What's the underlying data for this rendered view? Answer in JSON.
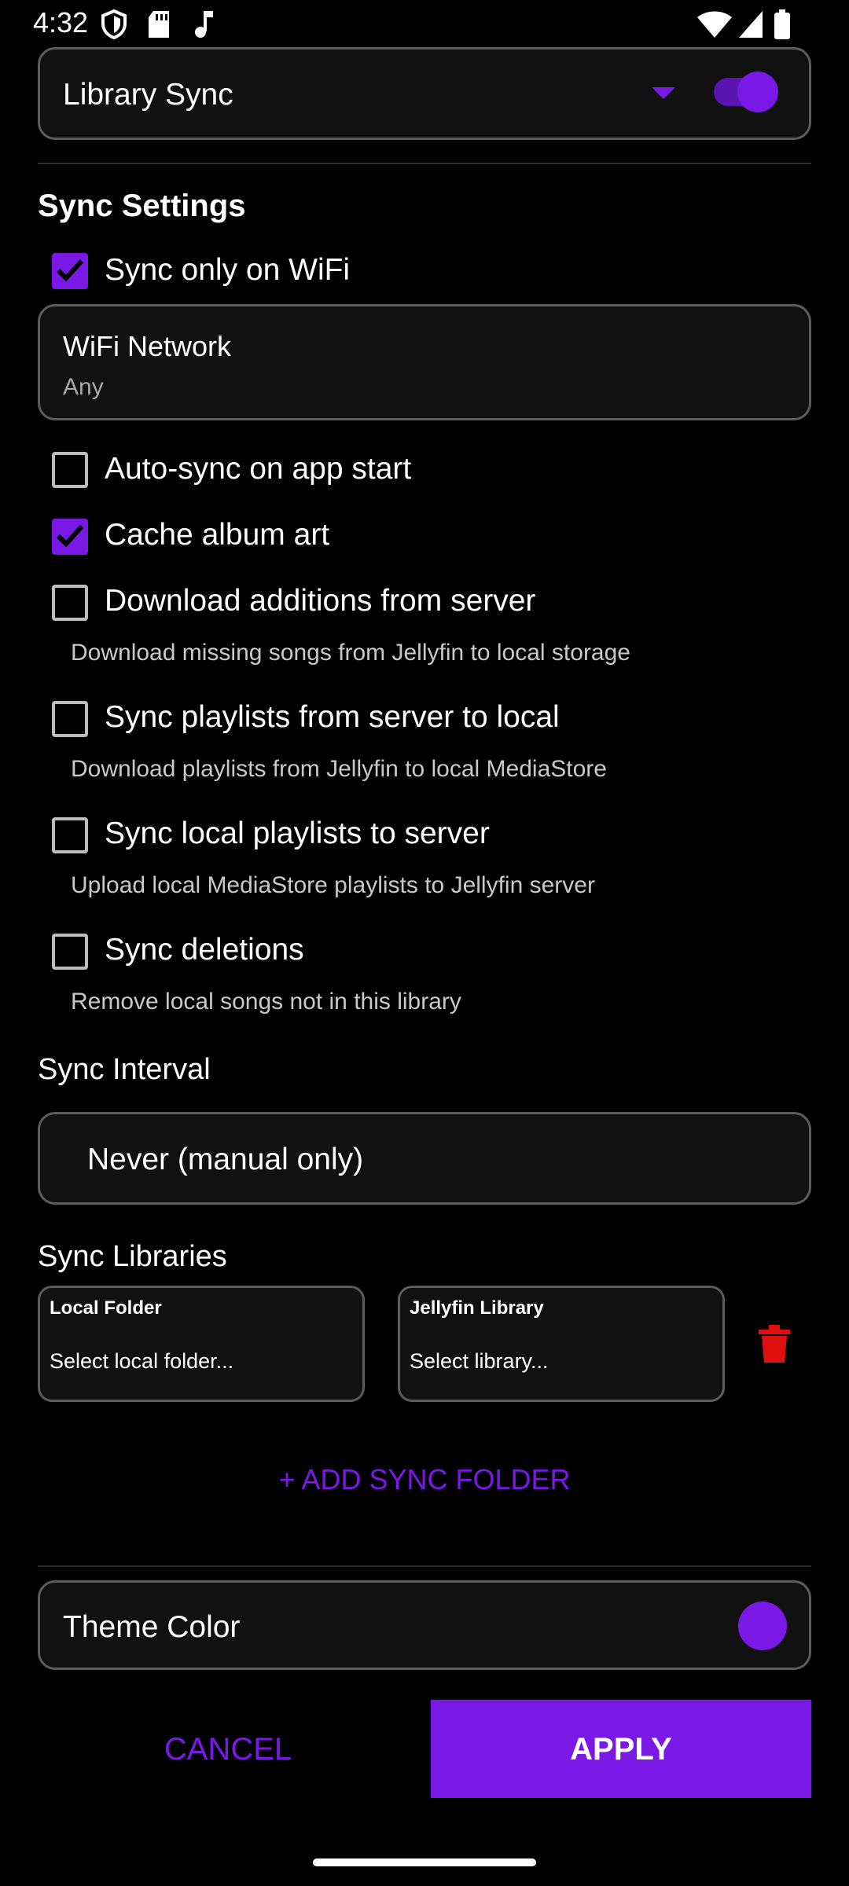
{
  "status_bar": {
    "time": "4:32",
    "icons": [
      "shield-icon",
      "sd-card-icon",
      "music-note-icon",
      "wifi-icon",
      "signal-icon",
      "battery-icon"
    ]
  },
  "library_card": {
    "title": "Library Sync",
    "dropdown_icon": "chevron-down-icon",
    "toggle_on": true
  },
  "sync_settings": {
    "title": "Sync Settings",
    "wifi_only": {
      "label": "Sync only on WiFi",
      "checked": true
    },
    "wifi_network": {
      "label": "WiFi Network",
      "value": "Any"
    },
    "options": [
      {
        "label": "Auto-sync on app start",
        "checked": false,
        "description": ""
      },
      {
        "label": "Cache album art",
        "checked": true,
        "description": ""
      },
      {
        "label": "Download additions from server",
        "checked": false,
        "description": "Download missing songs from Jellyfin to local storage"
      },
      {
        "label": "Sync playlists from server to local",
        "checked": false,
        "description": "Download playlists from Jellyfin to local MediaStore"
      },
      {
        "label": "Sync local playlists to server",
        "checked": false,
        "description": "Upload local MediaStore playlists to Jellyfin server"
      },
      {
        "label": "Sync deletions",
        "checked": false,
        "description": "Remove local songs not in this library"
      }
    ]
  },
  "sync_interval": {
    "title": "Sync Interval",
    "value": "Never (manual only)"
  },
  "sync_libraries": {
    "title": "Sync Libraries",
    "local_folder": {
      "label": "Local Folder",
      "placeholder": "Select local folder..."
    },
    "jellyfin_library": {
      "label": "Jellyfin Library",
      "placeholder": "Select library..."
    },
    "delete_icon": "trash-icon",
    "add_button": "+ ADD SYNC FOLDER"
  },
  "theme": {
    "label": "Theme Color",
    "color": "#7a19e6"
  },
  "footer": {
    "cancel": "CANCEL",
    "apply": "APPLY"
  },
  "colors": {
    "accent": "#7a19e6",
    "delete": "#e01010",
    "background": "#000000"
  }
}
